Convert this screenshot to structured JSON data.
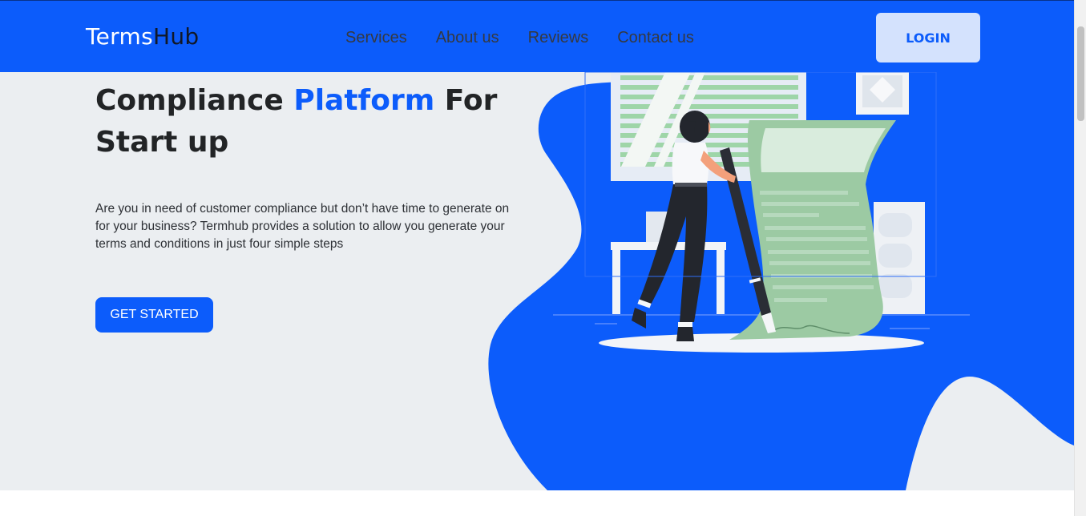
{
  "header": {
    "brand_part1": "Terms",
    "brand_part2": "Hub",
    "nav": [
      "Services",
      "About us",
      "Reviews",
      "Contact us"
    ],
    "login_label": "LOGIN"
  },
  "hero": {
    "title_part1": "Compliance ",
    "title_accent": "Platform",
    "title_part2": " For Start up",
    "description": "Are you in need of customer compliance but don’t have time to generate on for your business? Termhub provides a solution to allow you generate your terms and conditions in just four simple steps",
    "cta_label": "GET STARTED"
  },
  "colors": {
    "primary": "#0c5cfb",
    "hero_background": "#ebeef1",
    "login_background": "#d4e2fd",
    "illustration_green": "#9ccaa3"
  }
}
